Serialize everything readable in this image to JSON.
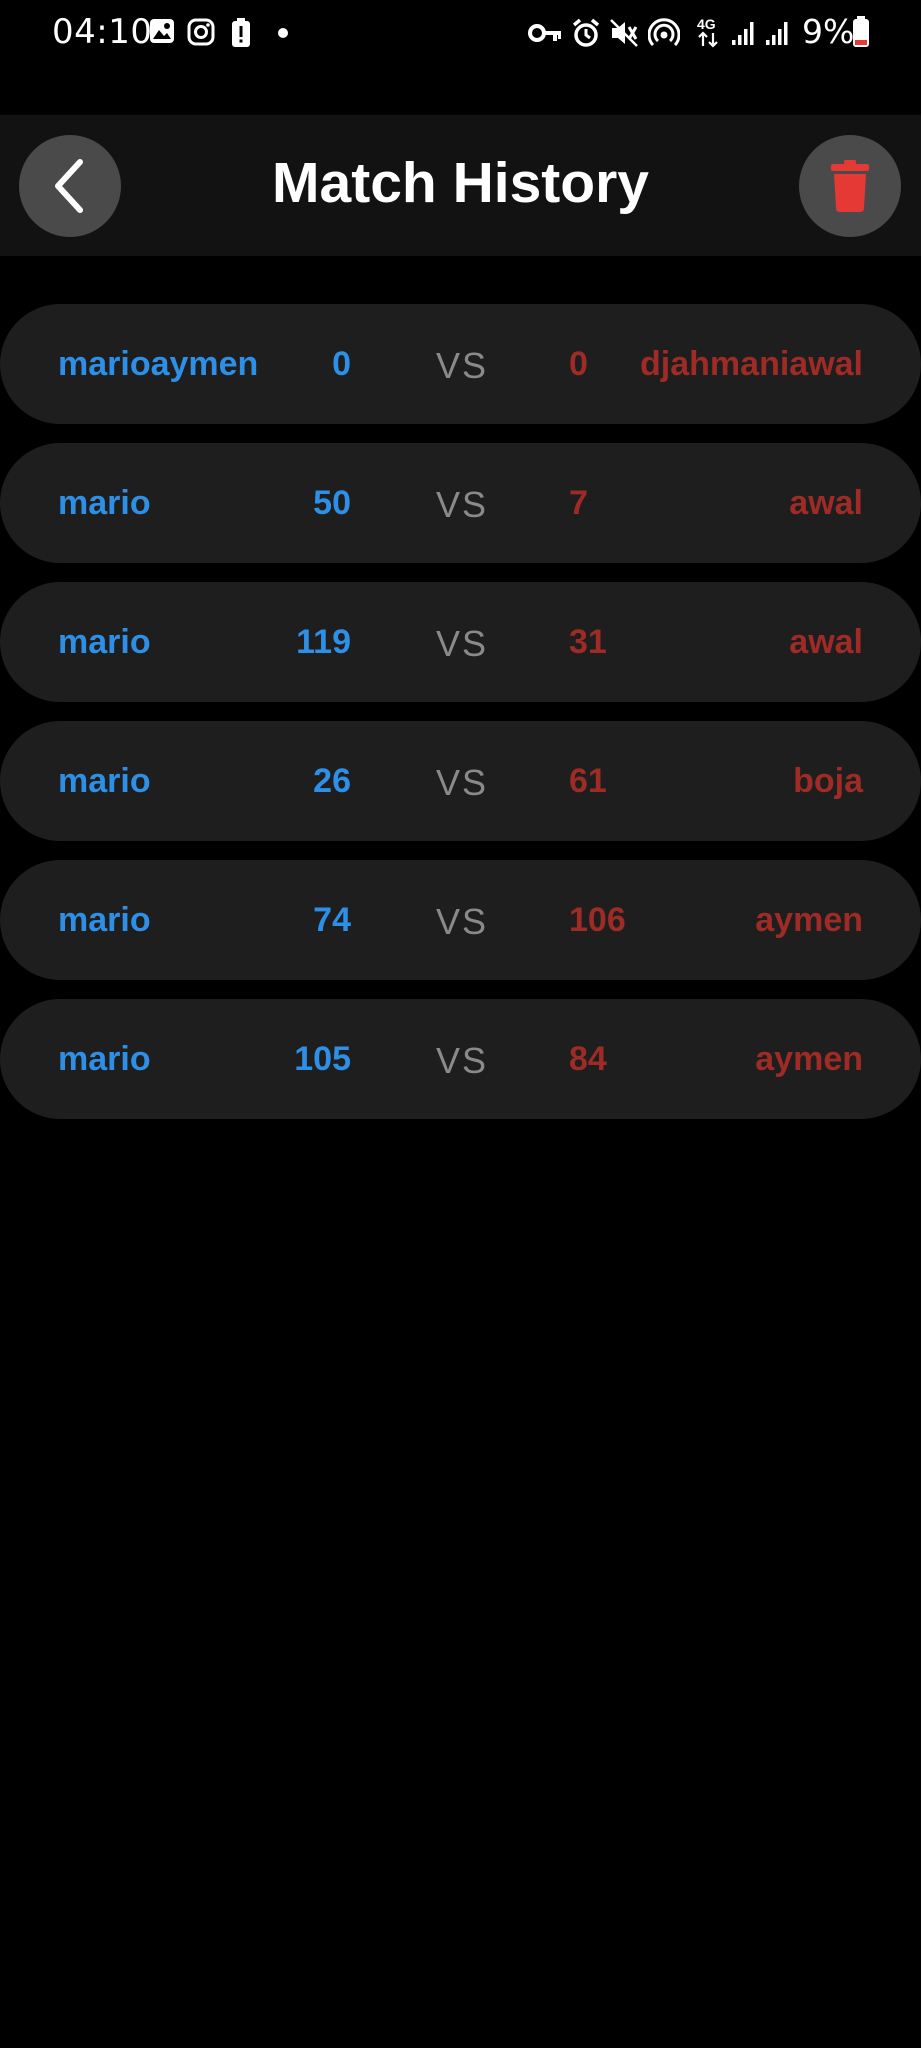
{
  "status_bar": {
    "time": "04:10",
    "battery_percent": "9%",
    "icons": [
      "gallery-icon",
      "instagram-icon",
      "battery-alert-icon",
      "dot-icon",
      "vpn-key-icon",
      "alarm-icon",
      "mute-icon",
      "hotspot-icon",
      "4g-icon",
      "signal-icon",
      "signal-icon",
      "battery-icon"
    ]
  },
  "app_bar": {
    "title": "Match History",
    "back_icon": "chevron-left-icon",
    "delete_icon": "trash-icon"
  },
  "colors": {
    "background": "#000000",
    "app_bar": "#121212",
    "card": "#1e1e1e",
    "button": "#4a4a4a",
    "player1": "#2e8fe6",
    "player2": "#9e2b25",
    "vs": "#8a8a8a",
    "trash": "#e53935"
  },
  "vs_label": "VS",
  "matches": [
    {
      "player1": "marioaymen",
      "score1": "0",
      "score2": "0",
      "player2": "djahmaniawal"
    },
    {
      "player1": "mario",
      "score1": "50",
      "score2": "7",
      "player2": "awal"
    },
    {
      "player1": "mario",
      "score1": "119",
      "score2": "31",
      "player2": "awal"
    },
    {
      "player1": "mario",
      "score1": "26",
      "score2": "61",
      "player2": "boja"
    },
    {
      "player1": "mario",
      "score1": "74",
      "score2": "106",
      "player2": "aymen"
    },
    {
      "player1": "mario",
      "score1": "105",
      "score2": "84",
      "player2": "aymen"
    }
  ]
}
